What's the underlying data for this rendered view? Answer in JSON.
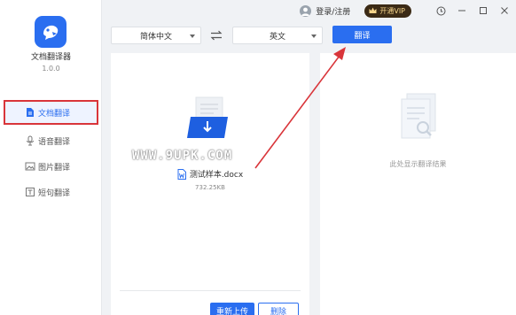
{
  "app": {
    "name": "文档翻译器",
    "version": "1.0.0",
    "accent": "#2a6ef0"
  },
  "sidebar": {
    "items": [
      {
        "label": "文档翻译",
        "icon": "document-icon",
        "active": true
      },
      {
        "label": "语音翻译",
        "icon": "microphone-icon",
        "active": false
      },
      {
        "label": "图片翻译",
        "icon": "image-icon",
        "active": false
      },
      {
        "label": "短句翻译",
        "icon": "text-icon",
        "active": false
      }
    ]
  },
  "titlebar": {
    "login_label": "登录/注册",
    "vip_label": "开通VIP",
    "controls": [
      "settings-icon",
      "minimize-icon",
      "maximize-icon",
      "close-icon"
    ]
  },
  "language_bar": {
    "source_lang": "简体中文",
    "target_lang": "英文",
    "translate_label": "翻译"
  },
  "left_panel": {
    "file_name": "测试样本.docx",
    "file_size": "732.25KB",
    "reupload_label": "重新上传",
    "delete_label": "删除"
  },
  "right_panel": {
    "placeholder": "此处显示翻译结果"
  },
  "watermark": "WWW.9UPK.COM",
  "annotation_color": "#d9353a"
}
